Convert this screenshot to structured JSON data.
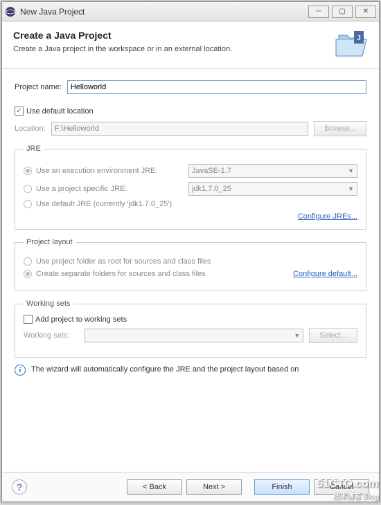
{
  "window": {
    "title": "New Java Project"
  },
  "banner": {
    "title": "Create a Java Project",
    "subtitle": "Create a Java project in the workspace or in an external location."
  },
  "project": {
    "name_label": "Project name:",
    "name_value": "Helloworld",
    "use_default_label": "Use default location",
    "location_label": "Location:",
    "location_value": "F:\\Helloworld",
    "browse_label": "Browse..."
  },
  "jre": {
    "group_label": "JRE",
    "exec_env_label": "Use an execution environment JRE:",
    "exec_env_value": "JavaSE-1.7",
    "project_jre_label": "Use a project specific JRE:",
    "project_jre_value": "jdk1.7.0_25",
    "default_jre_label": "Use default JRE (currently 'jdk1.7.0_25')",
    "configure_link": "Configure JREs..."
  },
  "layout": {
    "group_label": "Project layout",
    "root_label": "Use project folder as root for sources and class files",
    "separate_label": "Create separate folders for sources and class files",
    "configure_link": "Configure default..."
  },
  "working_sets": {
    "group_label": "Working sets",
    "add_label": "Add project to working sets",
    "ws_label": "Working sets:",
    "select_label": "Select..."
  },
  "info": {
    "text": "The wizard will automatically configure the JRE and the project layout based on"
  },
  "footer": {
    "back": "< Back",
    "next": "Next >",
    "finish": "Finish",
    "cancel": "Cancel"
  },
  "watermark": {
    "main": "51CTO.com",
    "sub": "技术博客 Blog"
  }
}
